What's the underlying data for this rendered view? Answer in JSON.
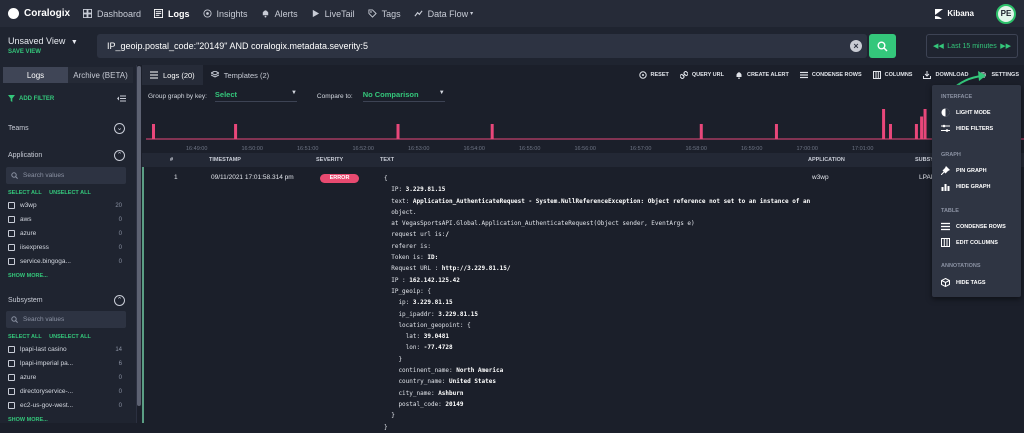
{
  "app": {
    "name": "Coralogix"
  },
  "nav": {
    "items": [
      {
        "label": "Dashboard",
        "icon": "dashboard-icon"
      },
      {
        "label": "Logs",
        "icon": "logs-icon",
        "active": true
      },
      {
        "label": "Insights",
        "icon": "insights-icon"
      },
      {
        "label": "Alerts",
        "icon": "bell-icon"
      },
      {
        "label": "LiveTail",
        "icon": "play-icon"
      },
      {
        "label": "Tags",
        "icon": "tag-icon"
      },
      {
        "label": "Data Flow",
        "icon": "data-flow-icon"
      }
    ],
    "kibana": "Kibana",
    "avatar": "PE"
  },
  "query": {
    "view_name": "Unsaved View",
    "save_view": "SAVE VIEW",
    "text": "IP_geoip.postal_code:\"20149\" AND coralogix.metadata.severity:5",
    "time_range": "Last 15 minutes"
  },
  "sidebar": {
    "tabs": [
      "Logs",
      "Archive (BETA)"
    ],
    "add_filter": "ADD FILTER",
    "teams": "Teams",
    "application": {
      "title": "Application",
      "search_placeholder": "Search values",
      "select_all": "SELECT ALL",
      "unselect_all": "UNSELECT ALL",
      "items": [
        {
          "label": "w3wp",
          "count": "20"
        },
        {
          "label": "aws",
          "count": "0"
        },
        {
          "label": "azure",
          "count": "0"
        },
        {
          "label": "iisexpress",
          "count": "0"
        },
        {
          "label": "service.bingoga...",
          "count": "0"
        }
      ],
      "show_more": "SHOW MORE..."
    },
    "subsystem": {
      "title": "Subsystem",
      "search_placeholder": "Search values",
      "select_all": "SELECT ALL",
      "unselect_all": "UNSELECT ALL",
      "items": [
        {
          "label": "lpapi-last casino",
          "count": "14"
        },
        {
          "label": "lpapi-imperial pa...",
          "count": "6"
        },
        {
          "label": "azure",
          "count": "0"
        },
        {
          "label": "directoryservice-...",
          "count": "0"
        },
        {
          "label": "ec2-us-gov-west...",
          "count": "0"
        }
      ],
      "show_more": "SHOW MORE..."
    }
  },
  "main": {
    "tabs": [
      "Logs (20)",
      "Templates (2)"
    ],
    "actions": [
      "RESET",
      "QUERY URL",
      "CREATE ALERT",
      "CONDENSE ROWS",
      "COLUMNS",
      "DOWNLOAD",
      "SETTINGS"
    ],
    "group_by_label": "Group graph by key:",
    "group_by_value": "Select",
    "compare_label": "Compare to:",
    "compare_value": "No Comparison"
  },
  "chart_data": {
    "type": "bar",
    "x_ticks": [
      "16:49:00",
      "16:50:00",
      "16:51:00",
      "16:52:00",
      "16:53:00",
      "16:54:00",
      "16:55:00",
      "16:56:00",
      "16:57:00",
      "16:58:00",
      "16:59:00",
      "17:00:00",
      "17:01:00"
    ],
    "bars": [
      {
        "pos": 0.0,
        "value": 0.5
      },
      {
        "pos": 0.095,
        "value": 0.5
      },
      {
        "pos": 0.283,
        "value": 0.5
      },
      {
        "pos": 0.392,
        "value": 0.5
      },
      {
        "pos": 0.634,
        "value": 0.5
      },
      {
        "pos": 0.721,
        "value": 0.5
      },
      {
        "pos": 0.845,
        "value": 1.0
      },
      {
        "pos": 0.853,
        "value": 0.5
      },
      {
        "pos": 0.883,
        "value": 0.5
      },
      {
        "pos": 0.889,
        "value": 0.75
      },
      {
        "pos": 0.893,
        "value": 1.0
      }
    ]
  },
  "table": {
    "headers": [
      "#",
      "TIMESTAMP",
      "SEVERITY",
      "TEXT",
      "APPLICATION",
      "SUBSY"
    ],
    "rows": [
      {
        "num": "1",
        "timestamp": "09/11/2021 17:01:58.314 pm",
        "severity": "ERROR",
        "application": "w3wp",
        "subsystem": "LPAPI"
      }
    ]
  },
  "log_text": [
    "{",
    "  IP: 3.229.81.15",
    "  text: Application_AuthenticateRequest - System.NullReferenceException: Object reference not set to an instance of an",
    "  object.",
    "  at VegasSportsAPI.Global.Application_AuthenticateRequest(Object sender, EventArgs e)",
    "  request url is:/",
    "  referer is:",
    "  Token is: ID:",
    "  Request URL : http://3.229.81.15/",
    "  IP : 162.142.125.42",
    "  IP_geoip: {",
    "    ip: 3.229.81.15",
    "    ip_ipaddr: 3.229.81.15",
    "    location_geopoint: {",
    "      lat: 39.0481",
    "      lon: -77.4728",
    "    }",
    "    continent_name: North America",
    "    country_name: United States",
    "    city_name: Ashburn",
    "    postal_code: 20149",
    "  }",
    "}"
  ],
  "settings": {
    "sections": [
      {
        "title": "INTERFACE",
        "items": [
          {
            "label": "LIGHT MODE",
            "icon": "light-mode-icon"
          },
          {
            "label": "HIDE FILTERS",
            "icon": "filters-icon"
          }
        ]
      },
      {
        "title": "GRAPH",
        "items": [
          {
            "label": "PIN GRAPH",
            "icon": "pin-icon"
          },
          {
            "label": "HIDE GRAPH",
            "icon": "graph-icon"
          }
        ]
      },
      {
        "title": "TABLE",
        "items": [
          {
            "label": "CONDENSE ROWS",
            "icon": "condense-icon"
          },
          {
            "label": "EDIT COLUMNS",
            "icon": "columns-icon"
          }
        ]
      },
      {
        "title": "ANNOTATIONS",
        "items": [
          {
            "label": "HIDE TAGS",
            "icon": "tag-icon"
          }
        ]
      }
    ]
  },
  "colors": {
    "accent": "#34c77b",
    "error": "#e84a70",
    "bar": "#e8477a"
  }
}
